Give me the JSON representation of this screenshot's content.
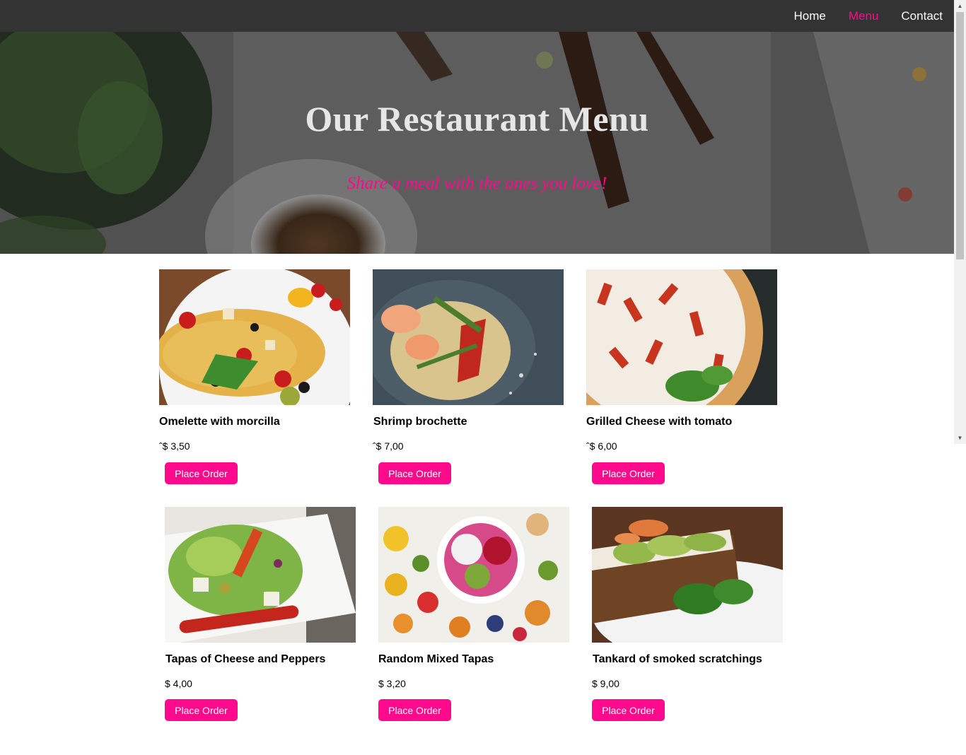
{
  "nav": {
    "items": [
      {
        "label": "Home"
      },
      {
        "label": "Menu"
      },
      {
        "label": "Contact"
      }
    ]
  },
  "hero": {
    "title": "Our Restaurant Menu",
    "subtitle": "Share a meal with the ones you love!"
  },
  "menu": {
    "items": [
      {
        "title": "Omelette with morcilla",
        "price": "ˆ$ 3,50",
        "button": "Place Order"
      },
      {
        "title": "Shrimp brochette",
        "price": "ˆ$ 7,00",
        "button": "Place Order"
      },
      {
        "title": "Grilled Cheese with tomato",
        "price": "ˆ$ 6,00",
        "button": "Place Order"
      },
      {
        "title": "Tapas of Cheese and Peppers",
        "price": "$ 4,00",
        "button": "Place Order"
      },
      {
        "title": "Random Mixed Tapas",
        "price": "$ 3,20",
        "button": "Place Order"
      },
      {
        "title": "Tankard of smoked scratchings",
        "price": "$ 9,00",
        "button": "Place Order"
      }
    ]
  },
  "colors": {
    "accent": "#ff0a8c",
    "navbar": "#333333"
  }
}
